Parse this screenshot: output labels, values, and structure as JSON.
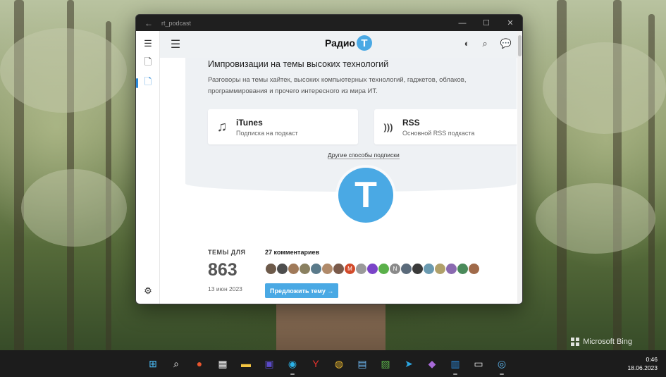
{
  "window": {
    "title": "rt_podcast",
    "back_icon": "arrow-left-icon",
    "minimize": "—",
    "maximize": "☐",
    "close": "✕"
  },
  "sidebar": {
    "items": [
      {
        "name": "hamburger-icon",
        "glyph": "☰"
      },
      {
        "name": "document-icon",
        "glyph": "🗋"
      },
      {
        "name": "document-icon",
        "glyph": "🗋",
        "active": true
      }
    ],
    "settings_glyph": "⚙"
  },
  "topbar": {
    "menu_glyph": "☰",
    "logo_word": "Радио",
    "logo_letter": "Т",
    "contrast_glyph": "◐",
    "search_glyph": "⌕",
    "chat_glyph": "💬"
  },
  "hero": {
    "headline": "Импровизации на темы высоких технологий",
    "description": "Разговоры на темы хайтек, высоких компьютерных технологий, гаджетов, облаков, программирования и прочего интересного из мира ИТ."
  },
  "cards": [
    {
      "title": "iTunes",
      "subtitle": "Подписка на подкаст",
      "icon": "music-note-icon",
      "glyph": "♫"
    },
    {
      "title": "RSS",
      "subtitle": "Основной RSS подкаста",
      "icon": "rss-icon",
      "glyph": ")))"
    }
  ],
  "other_subscriptions": "Другие способы подписки",
  "big_logo_letter": "Т",
  "stats": {
    "label": "ТЕМЫ ДЛЯ",
    "number": "863",
    "date": "13 июн 2023",
    "comments": "27 комментариев",
    "suggest_button": "Предложить тему →"
  },
  "avatars": [
    {
      "color": "#6d5a4a",
      "text": ""
    },
    {
      "color": "#4d4d4d",
      "text": ""
    },
    {
      "color": "#a07a5a",
      "text": ""
    },
    {
      "color": "#8a8060",
      "text": ""
    },
    {
      "color": "#5a7a8a",
      "text": ""
    },
    {
      "color": "#b08a6a",
      "text": ""
    },
    {
      "color": "#7a5a4a",
      "text": ""
    },
    {
      "color": "#d24a2a",
      "text": "M"
    },
    {
      "color": "#9a9a9a",
      "text": ""
    },
    {
      "color": "#7a44c8",
      "text": ""
    },
    {
      "color": "#5ab04a",
      "text": ""
    },
    {
      "color": "#8a8a8a",
      "text": "N"
    },
    {
      "color": "#5a6a7a",
      "text": ""
    },
    {
      "color": "#3a3a3a",
      "text": ""
    },
    {
      "color": "#6a9ab0",
      "text": ""
    },
    {
      "color": "#b0a06a",
      "text": ""
    },
    {
      "color": "#8a6ab0",
      "text": ""
    },
    {
      "color": "#4a8a5a",
      "text": ""
    },
    {
      "color": "#a06a4a",
      "text": ""
    }
  ],
  "taskbar": {
    "icons": [
      {
        "name": "windows-start-icon",
        "glyph": "⊞",
        "color": "#4cc2ff"
      },
      {
        "name": "search-icon",
        "glyph": "⌕",
        "color": "#ffffff"
      },
      {
        "name": "remote-app-icon",
        "glyph": "●",
        "color": "#e8552e"
      },
      {
        "name": "store-icon",
        "glyph": "▦",
        "color": "#f2f2f2"
      },
      {
        "name": "file-explorer-icon",
        "glyph": "▬",
        "color": "#f4c542"
      },
      {
        "name": "save-app-icon",
        "glyph": "▣",
        "color": "#5a4ac8"
      },
      {
        "name": "edge-icon",
        "glyph": "◉",
        "color": "#2bb3e8"
      },
      {
        "name": "yandex-browser-icon",
        "glyph": "Y",
        "color": "#e8322e"
      },
      {
        "name": "chrome-icon",
        "glyph": "◍",
        "color": "#e8b62e"
      },
      {
        "name": "notepad-icon",
        "glyph": "▤",
        "color": "#6ab0e8"
      },
      {
        "name": "image-app-icon",
        "glyph": "▨",
        "color": "#5ab04a"
      },
      {
        "name": "telegram-icon",
        "glyph": "➤",
        "color": "#2ca5e0"
      },
      {
        "name": "visual-studio-icon",
        "glyph": "◆",
        "color": "#a86ad8"
      },
      {
        "name": "podcast-app-icon",
        "glyph": "▥",
        "color": "#2b88d8"
      },
      {
        "name": "paint-app-icon",
        "glyph": "▭",
        "color": "#f2f2f2"
      },
      {
        "name": "globe-app-icon",
        "glyph": "◎",
        "color": "#5ab0e8"
      }
    ],
    "time": "0:46",
    "date": "18.06.2023"
  },
  "watermark": "Microsoft Bing"
}
